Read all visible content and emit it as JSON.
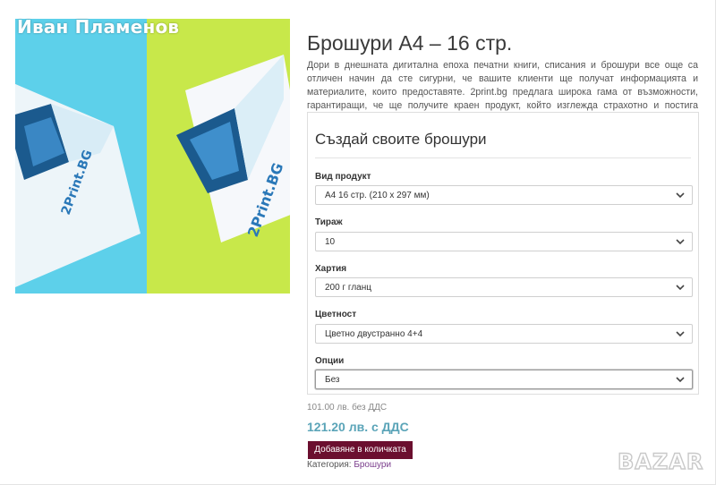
{
  "watermark": {
    "user_name": "Иван Пламенов"
  },
  "product": {
    "title": "Брошури А4 – 16 стр.",
    "description": "Дори в днешната дигитална епоха печатни книги, списания и брошури все още са отличен начин да сте сигурни, че вашите клиенти ще получат информацията и материалите, които предоставяте. 2print.bg предлага широка гама от възможности, гарантиращи, че ще получите краен продукт, който изглежда страхотно и постига своята цел.",
    "image": {
      "left_color": "#5dd0ea",
      "right_color": "#c8e84a",
      "brand_text": "2Print.BG"
    }
  },
  "form": {
    "title": "Създай своите брошури",
    "fields": [
      {
        "label": "Вид продукт",
        "value": "А4 16 стр. (210 x 297 мм)",
        "icon": "chevron-down-icon"
      },
      {
        "label": "Тираж",
        "value": "10",
        "icon": "chevron-down-icon"
      },
      {
        "label": "Хартия",
        "value": "200 г гланц",
        "icon": "chevron-down-icon"
      },
      {
        "label": "Цветност",
        "value": "Цветно двустранно 4+4",
        "icon": "chevron-down-icon"
      },
      {
        "label": "Опции",
        "value": "Без",
        "icon": "chevron-down-icon"
      }
    ]
  },
  "pricing": {
    "price_without_vat": "101.00 лв. без ДДС",
    "price_with_vat": "121.20 лв. с ДДС"
  },
  "actions": {
    "add_button_label": "Добавяне в количката"
  },
  "category": {
    "label": "Категория:",
    "link": "Брошури"
  },
  "logo": {
    "text": "BAZAR"
  },
  "colors": {
    "accent_button": "#6b0f2f",
    "price_color": "#5aa4b8",
    "category_link": "#7a3d8c"
  }
}
